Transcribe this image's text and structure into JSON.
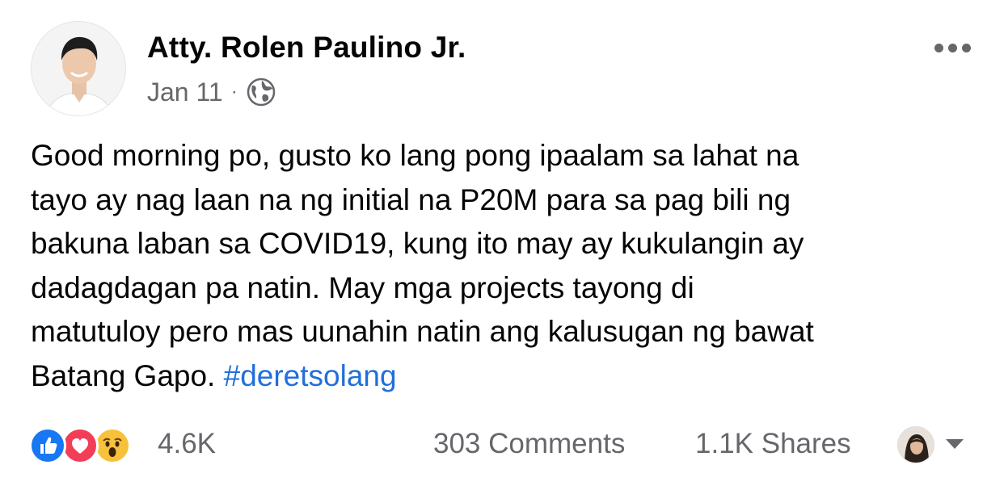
{
  "post": {
    "author": "Atty. Rolen Paulino Jr.",
    "date": "Jan 11",
    "separator": "·",
    "privacy_icon": "globe-icon",
    "body": "Good morning po, gusto ko lang pong ipaalam sa lahat na\ntayo ay nag laan na ng initial na P20M para sa pag bili ng\nbakuna laban sa COVID19, kung ito may ay kukulangin ay\ndadagdagan pa natin.  May mga projects tayong di\nmatutuloy pero mas uunahin natin ang kalusugan ng bawat\nBatang Gapo. ",
    "hashtag": "#deretsolang"
  },
  "engagement": {
    "reactions": [
      "like-icon",
      "love-icon",
      "wow-icon"
    ],
    "reaction_count": "4.6K",
    "comments": "303 Comments",
    "shares": "1.1K Shares"
  },
  "colors": {
    "text": "#050505",
    "secondary": "#65676b",
    "link": "#216fdb",
    "like": "#1877f2",
    "love": "#f33e58",
    "wow": "#f7c23b"
  }
}
